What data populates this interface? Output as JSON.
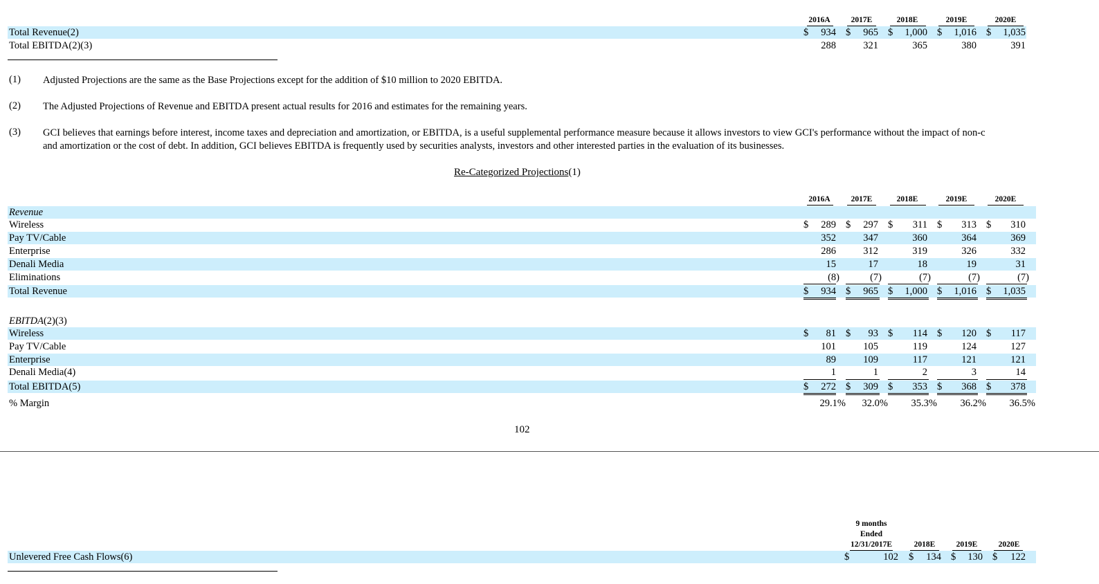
{
  "years": [
    "2016A",
    "2017E",
    "2018E",
    "2019E",
    "2020E"
  ],
  "adjusted": {
    "rows": [
      {
        "label": "Total Revenue(2)",
        "cells": [
          [
            "$",
            "934"
          ],
          [
            "$",
            "965"
          ],
          [
            "$",
            "1,000"
          ],
          [
            "$",
            "1,016"
          ],
          [
            "$",
            "1,035"
          ]
        ]
      },
      {
        "label": "Total EBITDA(2)(3)",
        "cells": [
          [
            "",
            "288"
          ],
          [
            "",
            "321"
          ],
          [
            "",
            "365"
          ],
          [
            "",
            "380"
          ],
          [
            "",
            "391"
          ]
        ]
      }
    ]
  },
  "footnotes": [
    {
      "num": "(1)",
      "lines": [
        "Adjusted Projections are the same as the Base Projections except for the addition of $10 million to 2020 EBITDA."
      ]
    },
    {
      "num": "(2)",
      "lines": [
        "The Adjusted Projections of Revenue and EBITDA present actual results for 2016 and estimates for the remaining years."
      ]
    },
    {
      "num": "(3)",
      "lines": [
        "GCI believes that earnings before interest, income taxes and depreciation and amortization, or EBITDA, is a useful supplemental performance measure because it allows investors to view GCI's performance without the impact of non-c",
        "and amortization or the cost of debt. In addition, GCI believes EBITDA is frequently used by securities analysts, investors and other interested parties in the evaluation of its businesses."
      ]
    }
  ],
  "recat": {
    "title": "Re-Categorized Projections",
    "title_suffix": "(1)",
    "revenue_heading": "Revenue",
    "revenue_rows": [
      {
        "label": "Wireless",
        "cells": [
          [
            "$",
            "289"
          ],
          [
            "$",
            "297"
          ],
          [
            "$",
            "311"
          ],
          [
            "$",
            "313"
          ],
          [
            "$",
            "310"
          ]
        ]
      },
      {
        "label": "Pay TV/Cable",
        "cells": [
          [
            "",
            "352"
          ],
          [
            "",
            "347"
          ],
          [
            "",
            "360"
          ],
          [
            "",
            "364"
          ],
          [
            "",
            "369"
          ]
        ]
      },
      {
        "label": "Enterprise",
        "cells": [
          [
            "",
            "286"
          ],
          [
            "",
            "312"
          ],
          [
            "",
            "319"
          ],
          [
            "",
            "326"
          ],
          [
            "",
            "332"
          ]
        ]
      },
      {
        "label": "Denali Media",
        "cells": [
          [
            "",
            "15"
          ],
          [
            "",
            "17"
          ],
          [
            "",
            "18"
          ],
          [
            "",
            "19"
          ],
          [
            "",
            "31"
          ]
        ]
      },
      {
        "label": "Eliminations",
        "cells": [
          [
            "",
            "(8)"
          ],
          [
            "",
            "(7)"
          ],
          [
            "",
            "(7)"
          ],
          [
            "",
            "(7)"
          ],
          [
            "",
            "(7)"
          ]
        ]
      },
      {
        "label": "Total Revenue",
        "cells": [
          [
            "$",
            "934"
          ],
          [
            "$",
            "965"
          ],
          [
            "$",
            "1,000"
          ],
          [
            "$",
            "1,016"
          ],
          [
            "$",
            "1,035"
          ]
        ]
      }
    ],
    "ebitda_heading": "EBITDA",
    "ebitda_heading_suffix": "(2)(3)",
    "ebitda_rows": [
      {
        "label": "Wireless",
        "cells": [
          [
            "$",
            "81"
          ],
          [
            "$",
            "93"
          ],
          [
            "$",
            "114"
          ],
          [
            "$",
            "120"
          ],
          [
            "$",
            "117"
          ]
        ]
      },
      {
        "label": "Pay TV/Cable",
        "cells": [
          [
            "",
            "101"
          ],
          [
            "",
            "105"
          ],
          [
            "",
            "119"
          ],
          [
            "",
            "124"
          ],
          [
            "",
            "127"
          ]
        ]
      },
      {
        "label": "Enterprise",
        "cells": [
          [
            "",
            "89"
          ],
          [
            "",
            "109"
          ],
          [
            "",
            "117"
          ],
          [
            "",
            "121"
          ],
          [
            "",
            "121"
          ]
        ]
      },
      {
        "label": "Denali Media(4)",
        "cells": [
          [
            "",
            "1"
          ],
          [
            "",
            "1"
          ],
          [
            "",
            "2"
          ],
          [
            "",
            "3"
          ],
          [
            "",
            "14"
          ]
        ]
      },
      {
        "label": "Total EBITDA(5)",
        "cells": [
          [
            "$",
            "272"
          ],
          [
            "$",
            "309"
          ],
          [
            "$",
            "353"
          ],
          [
            "$",
            "368"
          ],
          [
            "$",
            "378"
          ]
        ]
      }
    ],
    "margin": {
      "label": "% Margin",
      "values": [
        "29.1%",
        "32.0%",
        "35.3%",
        "36.2%",
        "36.5%"
      ]
    }
  },
  "page_number": "102",
  "ufcf": {
    "headers": [
      "9 months Ended 12/31/2017E",
      "2018E",
      "2019E",
      "2020E"
    ],
    "header_first_lines": [
      "9 months",
      "Ended",
      "12/31/2017E"
    ],
    "label": "Unlevered Free Cash Flows(6)",
    "cells": [
      [
        "$",
        "102"
      ],
      [
        "$",
        "134"
      ],
      [
        "$",
        "130"
      ],
      [
        "$",
        "122"
      ]
    ]
  }
}
